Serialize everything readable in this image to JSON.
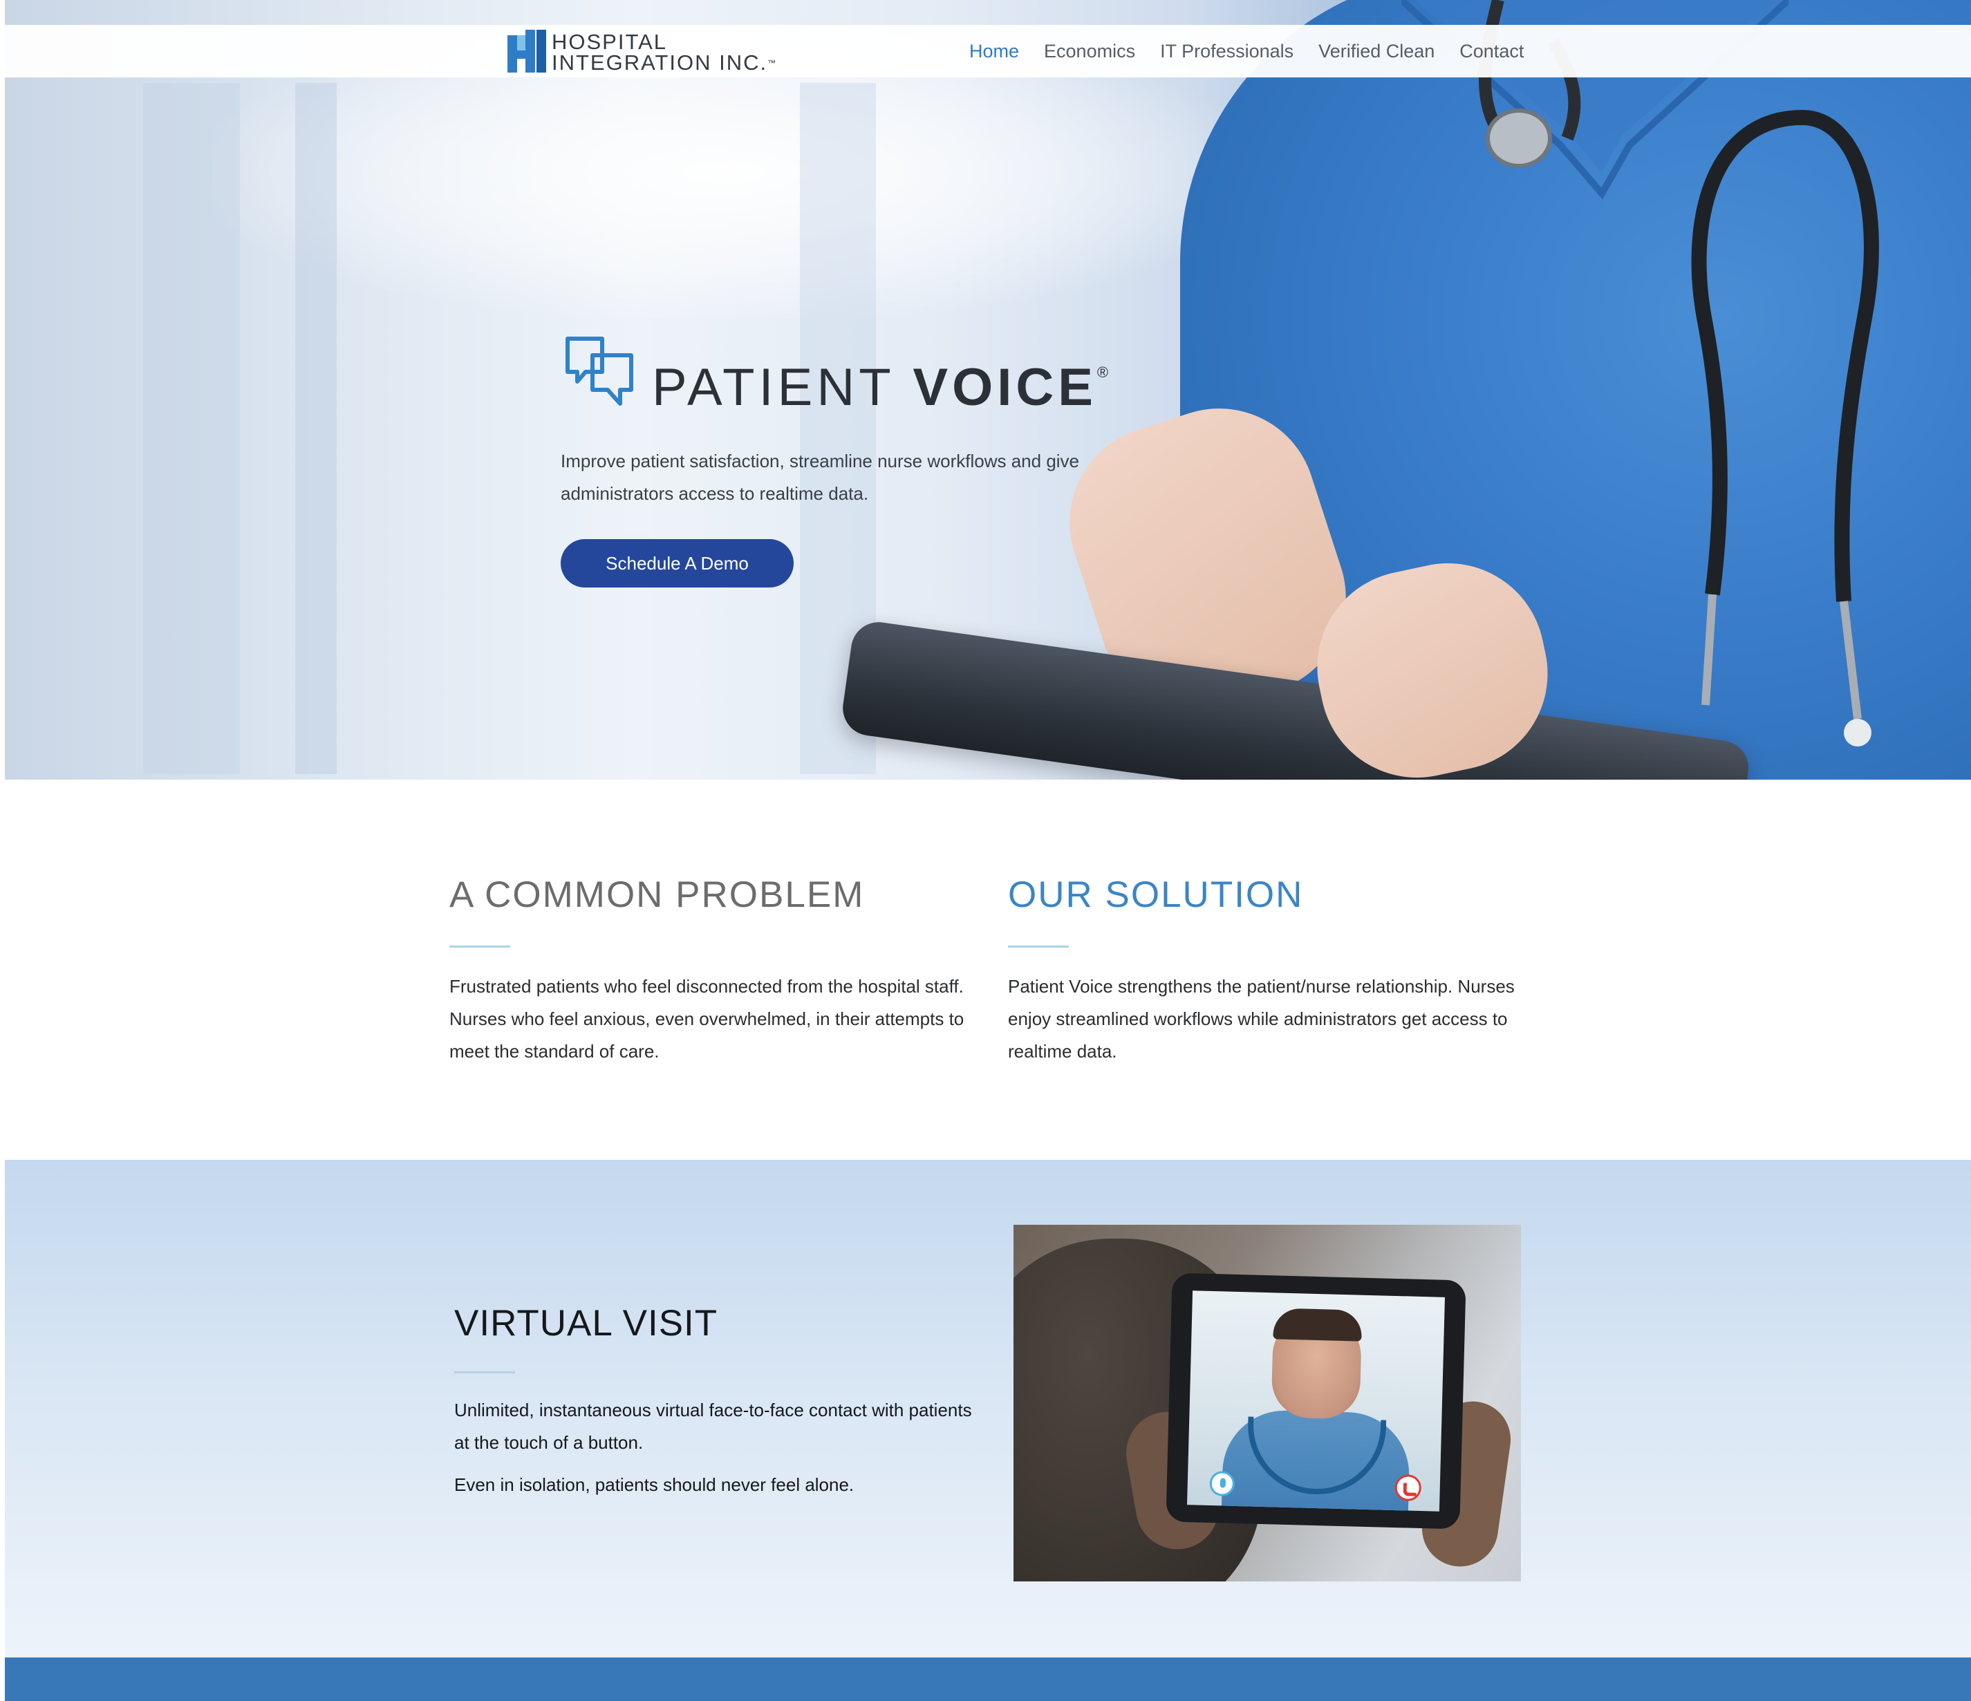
{
  "brand": {
    "company_line1": "HOSPITAL",
    "company_line2": "INTEGRATION INC.",
    "company_tm": "™",
    "product_light": "PATIENT",
    "product_bold": "VOICE",
    "product_reg": "®"
  },
  "nav": {
    "items": [
      {
        "label": "Home",
        "active": true
      },
      {
        "label": "Economics",
        "active": false
      },
      {
        "label": "IT Professionals",
        "active": false
      },
      {
        "label": "Verified Clean",
        "active": false
      },
      {
        "label": "Contact",
        "active": false
      }
    ]
  },
  "hero": {
    "tagline": "Improve patient satisfaction, streamline nurse workflows and give administrators access to realtime data.",
    "cta_label": "Schedule A Demo"
  },
  "problem": {
    "title": "A COMMON PROBLEM",
    "body": "Frustrated patients who feel disconnected from the hospital staff. Nurses who feel anxious, even overwhelmed, in their attempts to meet the standard of care."
  },
  "solution": {
    "title": "OUR SOLUTION",
    "body": "Patient Voice strengthens the patient/nurse relationship. Nurses enjoy streamlined workflows while administrators get access to realtime data."
  },
  "virtual_visit": {
    "title": "VIRTUAL VISIT",
    "body1": "Unlimited, instantaneous virtual face-to-face contact with patients at the touch of a button.",
    "body2": "Even in isolation, patients should never feel alone."
  },
  "colors": {
    "accent": "#2e7bc4",
    "cta": "#24479c",
    "solution_heading": "#3a85c6",
    "footer_bar": "#3978b8",
    "rule": "#a8d3ea"
  },
  "icons": [
    "hospital-integration-logo-icon",
    "patient-voice-speech-bubbles-icon",
    "microphone-icon",
    "end-call-icon"
  ]
}
